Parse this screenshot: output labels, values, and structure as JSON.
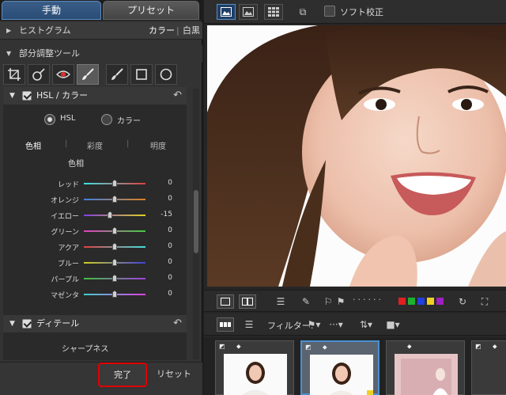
{
  "tabs": {
    "manual": "手動",
    "preset": "プリセット"
  },
  "histogram": {
    "label": "ヒストグラム",
    "color": "カラー",
    "sep": "|",
    "bw": "白黒"
  },
  "local_adjust": {
    "label": "部分調整ツール"
  },
  "hsl_section": {
    "title": "HSL / カラー",
    "radio_hsl": "HSL",
    "radio_color": "カラー",
    "subtabs": {
      "hue": "色相",
      "sat": "彩度",
      "lum": "明度"
    },
    "current_title": "色相",
    "sliders": [
      {
        "name": "レッド",
        "value": "0",
        "level": 0
      },
      {
        "name": "オレンジ",
        "value": "0",
        "level": 0
      },
      {
        "name": "イエロー",
        "value": "-15",
        "level": -15
      },
      {
        "name": "グリーン",
        "value": "0",
        "level": 0
      },
      {
        "name": "アクア",
        "value": "0",
        "level": 0
      },
      {
        "name": "ブルー",
        "value": "0",
        "level": 0
      },
      {
        "name": "パープル",
        "value": "0",
        "level": 0
      },
      {
        "name": "マゼンタ",
        "value": "0",
        "level": 0
      }
    ]
  },
  "detail_section": {
    "title": "ディテール",
    "sharpness": "シャープネス"
  },
  "bottom": {
    "done": "完了",
    "reset": "リセット"
  },
  "toolbar": {
    "soft_proof": "ソフト校正"
  },
  "filter": {
    "label": "フィルター:"
  },
  "colors": {
    "accent": "#5d8dc0",
    "highlight": "#e00000"
  }
}
